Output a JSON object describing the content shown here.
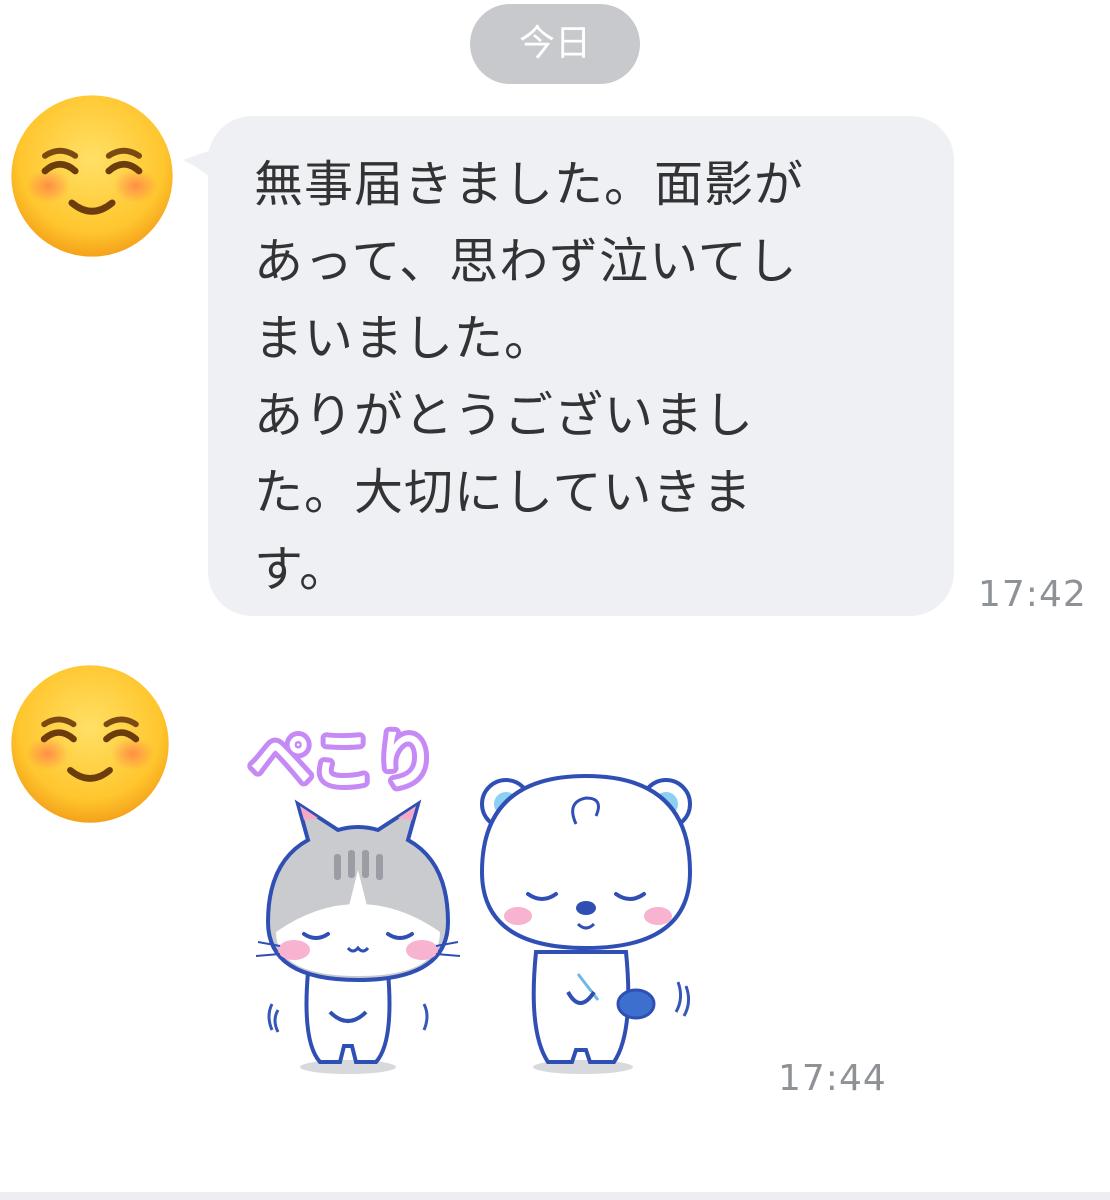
{
  "date_separator": "今日",
  "messages": [
    {
      "type": "text",
      "avatar_icon": "smiling-face-with-smiling-eyes-emoji",
      "lines": [
        "無事届きました。面影が",
        "あって、思わず泣いてし",
        "まいました。",
        "ありがとうございまし",
        "た。大切にしていきま",
        "す。"
      ],
      "time": "17:42"
    },
    {
      "type": "sticker",
      "avatar_icon": "smiling-face-with-smiling-eyes-emoji",
      "sticker_text": "ペこり",
      "sticker_icon": "bowing-cat-and-bear-sticker",
      "time": "17:44"
    }
  ],
  "colors": {
    "bubble_background": "#eef0f3",
    "date_pill_background": "#c8c9cc",
    "timestamp_text": "#8e9297",
    "message_text": "#333336",
    "sticker_text": "#c58af5"
  }
}
